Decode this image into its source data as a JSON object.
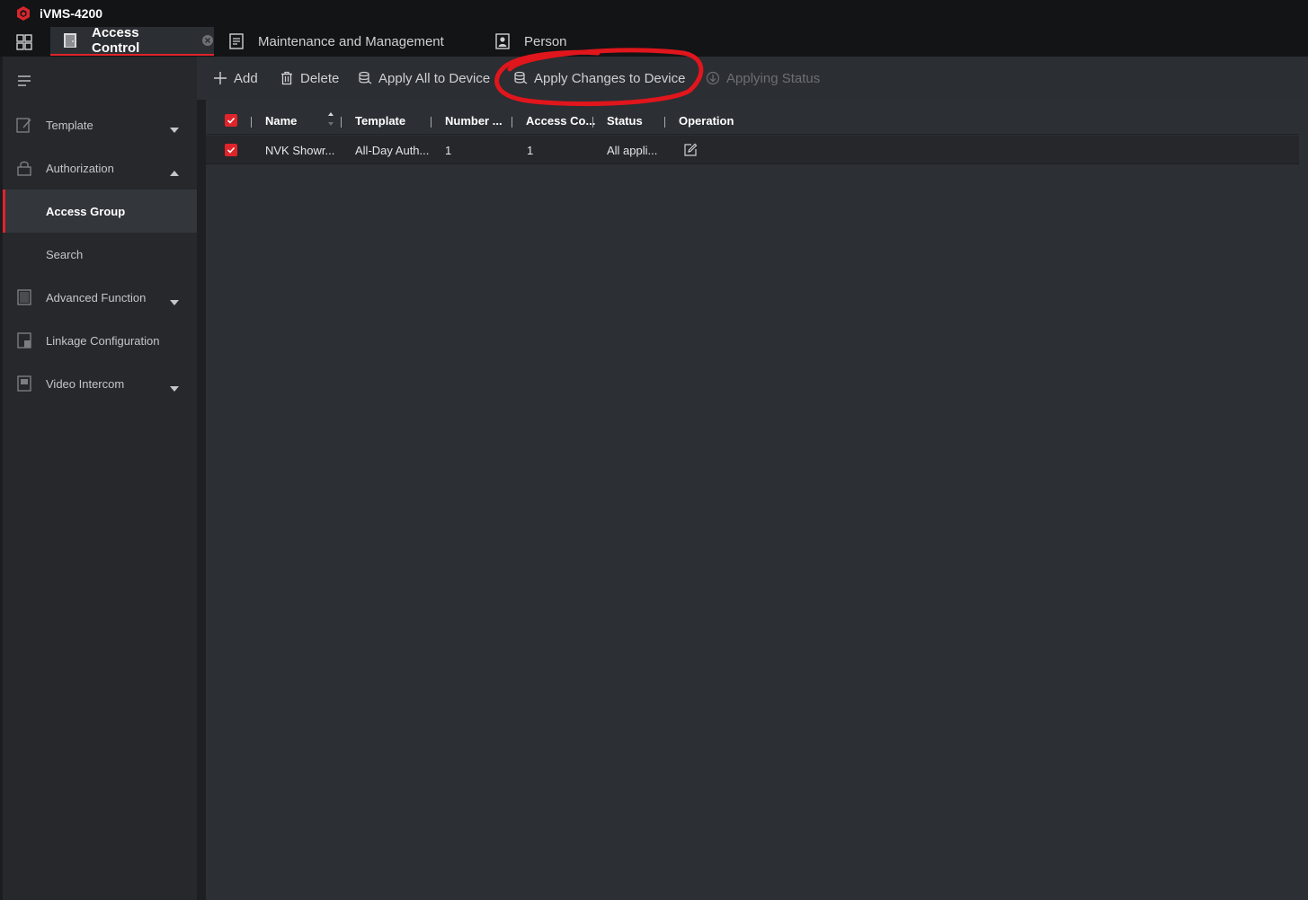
{
  "app": {
    "title": "iVMS-4200"
  },
  "tabs": [
    {
      "label": "Access Control",
      "icon": "door-icon",
      "active": true
    },
    {
      "label": "Maintenance and Management",
      "icon": "maintenance-icon"
    },
    {
      "label": "Person",
      "icon": "person-icon"
    }
  ],
  "sidebar": {
    "items": [
      {
        "label": "Template",
        "icon": "template-icon",
        "caret": "down"
      },
      {
        "label": "Authorization",
        "icon": "lock-icon",
        "caret": "up"
      },
      {
        "label": "Access Group",
        "selected": true
      },
      {
        "label": "Search"
      },
      {
        "label": "Advanced Function",
        "icon": "advanced-function-icon",
        "caret": "down"
      },
      {
        "label": "Linkage Configuration",
        "icon": "linkage-icon"
      },
      {
        "label": "Video Intercom",
        "icon": "video-intercom-icon",
        "caret": "down"
      }
    ]
  },
  "toolbar": {
    "add": "Add",
    "delete": "Delete",
    "apply_all": "Apply All to Device",
    "apply_changes": "Apply Changes to Device",
    "applying_status": "Applying Status"
  },
  "table": {
    "headers": {
      "name": "Name",
      "template": "Template",
      "number": "Number ...",
      "access_controller": "Access Co...",
      "status": "Status",
      "operation": "Operation"
    },
    "rows": [
      {
        "checked": true,
        "name": "NVK Showr...",
        "template": "All-Day Auth...",
        "number": "1",
        "access_controller": "1",
        "status": "All appli..."
      }
    ]
  },
  "colors": {
    "accent": "#e0242a",
    "background": "#1e1f22",
    "panel": "#2c2f34",
    "sidebar": "#26282c"
  }
}
